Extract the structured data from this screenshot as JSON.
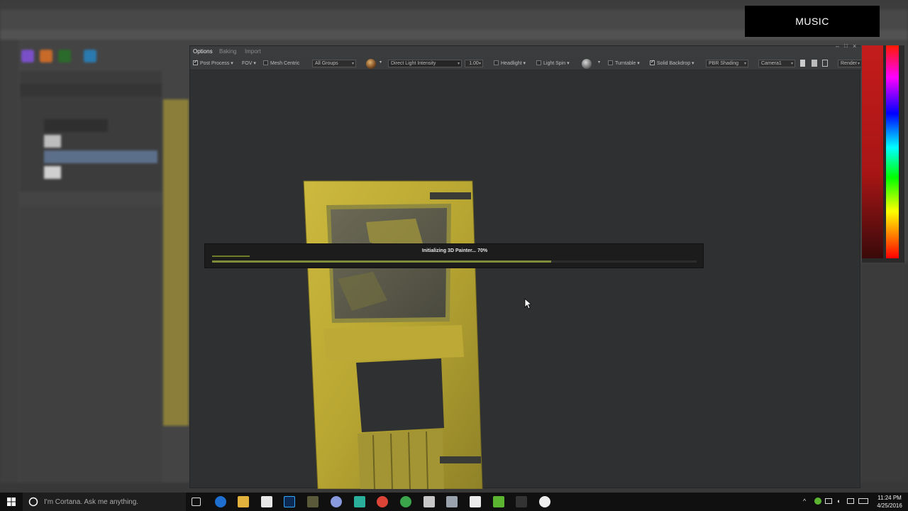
{
  "overlay": {
    "music_label": "MUSIC"
  },
  "viewer": {
    "tabs": [
      {
        "label": "Options"
      },
      {
        "label": "Baking"
      },
      {
        "label": "Import"
      }
    ],
    "toolbar": {
      "post_process": "Post Process",
      "fov": "FOV",
      "mesh_centric": "Mesh Centric",
      "groups": "All Groups",
      "light_label": "Direct Light Intensity",
      "light_value": "1.00",
      "headlight": "Headlight",
      "light_spin": "Light Spin",
      "turntable": "Turntable",
      "solid_backdrop": "Solid Backdrop",
      "shading": "PBR Shading",
      "camera": "Camera1",
      "render": "Render"
    },
    "loading": {
      "text": "Initializing 3D Painter... 70%",
      "progress": 0.7
    }
  },
  "taskbar": {
    "search_placeholder": "I'm Cortana. Ask me anything.",
    "time": "11:24 PM",
    "date": "4/25/2016"
  },
  "colors": {
    "accent_progress": "#7f8c3a",
    "viewport_bg": "#2f3031",
    "door_yellow": "#c9b53a"
  }
}
